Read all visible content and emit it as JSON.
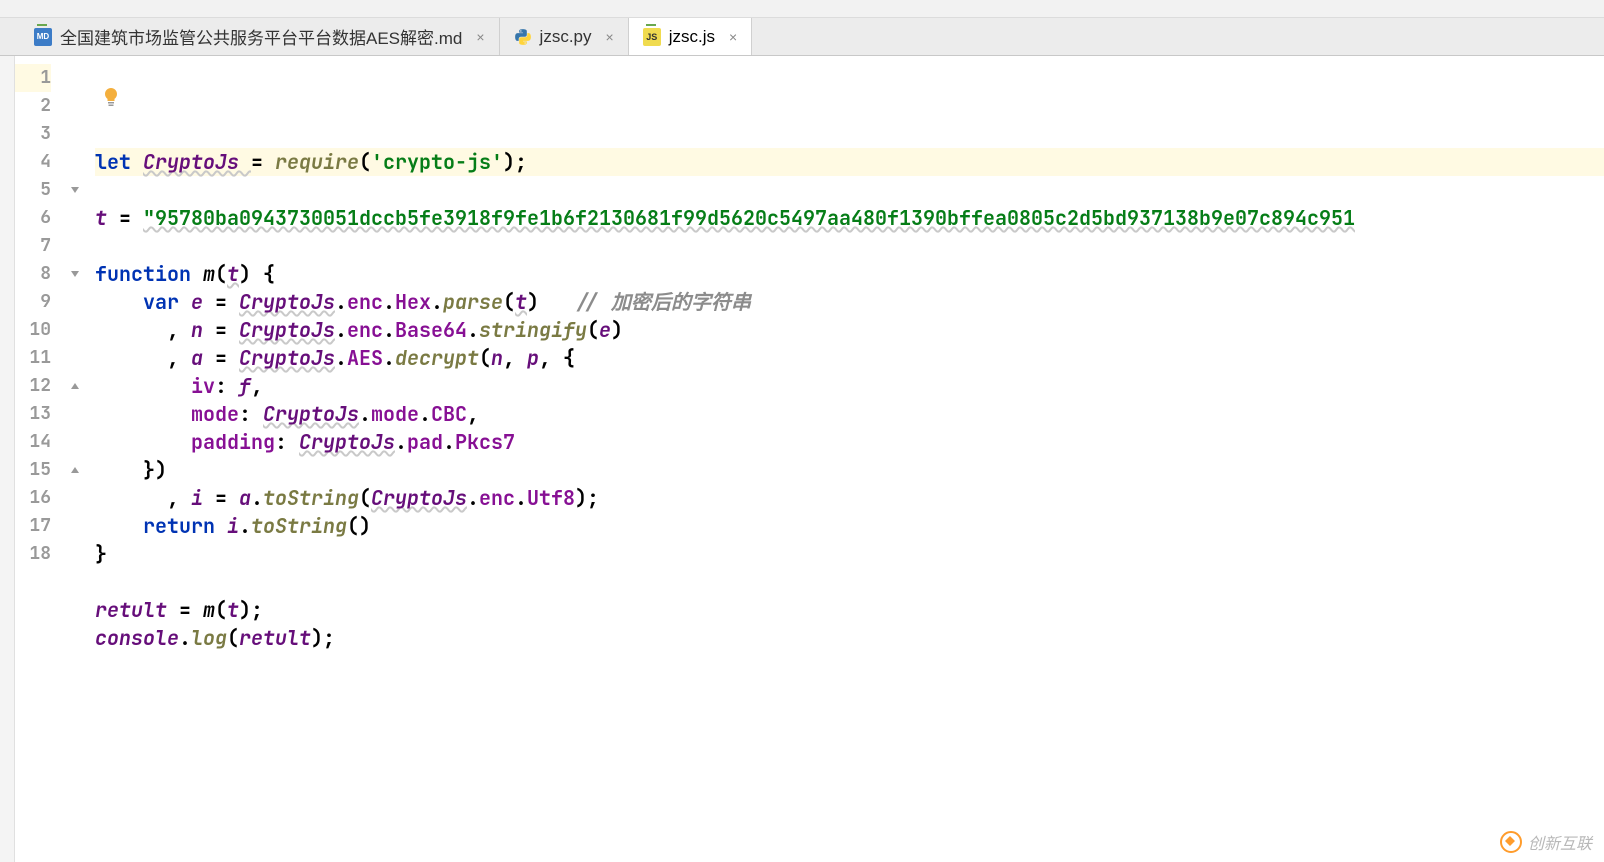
{
  "tabs": [
    {
      "label": "全国建筑市场监管公共服务平台平台数据AES解密.md",
      "icon": "md",
      "active": false
    },
    {
      "label": "jzsc.py",
      "icon": "py",
      "active": false
    },
    {
      "label": "jzsc.js",
      "icon": "js",
      "active": true
    }
  ],
  "gutter": {
    "start": 1,
    "end": 18
  },
  "code": {
    "lines": [
      {
        "n": 1,
        "highlighted": true,
        "fold": "",
        "tokens": [
          {
            "t": "let ",
            "c": "kw"
          },
          {
            "t": "CryptoJs ",
            "c": "id underline"
          },
          {
            "t": "= ",
            "c": "pn"
          },
          {
            "t": "require",
            "c": "method"
          },
          {
            "t": "(",
            "c": "pn"
          },
          {
            "t": "'crypto-js'",
            "c": "str"
          },
          {
            "t": ");",
            "c": "pn"
          }
        ]
      },
      {
        "n": 2,
        "tokens": []
      },
      {
        "n": 3,
        "tokens": [
          {
            "t": "t ",
            "c": "id"
          },
          {
            "t": "= ",
            "c": "pn"
          },
          {
            "t": "\"95780ba0943730051dccb5fe3918f9fe1b6f2130681f99d5620c5497aa480f1390bffea0805c2d5bd937138b9e07c894c951",
            "c": "str underline"
          }
        ]
      },
      {
        "n": 4,
        "tokens": []
      },
      {
        "n": 5,
        "fold": "open",
        "tokens": [
          {
            "t": "function ",
            "c": "kw"
          },
          {
            "t": "m",
            "c": "fn"
          },
          {
            "t": "(",
            "c": "pn"
          },
          {
            "t": "t",
            "c": "id underline"
          },
          {
            "t": ") {",
            "c": "pn"
          }
        ]
      },
      {
        "n": 6,
        "tokens": [
          {
            "t": "    ",
            "c": ""
          },
          {
            "t": "var ",
            "c": "kw"
          },
          {
            "t": "e ",
            "c": "id"
          },
          {
            "t": "= ",
            "c": "pn"
          },
          {
            "t": "CryptoJs",
            "c": "id underline"
          },
          {
            "t": ".",
            "c": "pn"
          },
          {
            "t": "enc",
            "c": "prop"
          },
          {
            "t": ".",
            "c": "pn"
          },
          {
            "t": "Hex",
            "c": "prop"
          },
          {
            "t": ".",
            "c": "pn"
          },
          {
            "t": "parse",
            "c": "method"
          },
          {
            "t": "(",
            "c": "pn"
          },
          {
            "t": "t",
            "c": "id underline"
          },
          {
            "t": ")   ",
            "c": "pn"
          },
          {
            "t": "// 加密后的字符串",
            "c": "cm"
          }
        ]
      },
      {
        "n": 7,
        "tokens": [
          {
            "t": "      , ",
            "c": "pn"
          },
          {
            "t": "n ",
            "c": "id"
          },
          {
            "t": "= ",
            "c": "pn"
          },
          {
            "t": "CryptoJs",
            "c": "id underline"
          },
          {
            "t": ".",
            "c": "pn"
          },
          {
            "t": "enc",
            "c": "prop"
          },
          {
            "t": ".",
            "c": "pn"
          },
          {
            "t": "Base64",
            "c": "prop"
          },
          {
            "t": ".",
            "c": "pn"
          },
          {
            "t": "stringify",
            "c": "method"
          },
          {
            "t": "(",
            "c": "pn"
          },
          {
            "t": "e",
            "c": "id"
          },
          {
            "t": ")",
            "c": "pn"
          }
        ]
      },
      {
        "n": 8,
        "fold": "open",
        "tokens": [
          {
            "t": "      , ",
            "c": "pn"
          },
          {
            "t": "a ",
            "c": "id"
          },
          {
            "t": "= ",
            "c": "pn"
          },
          {
            "t": "CryptoJs",
            "c": "id underline"
          },
          {
            "t": ".",
            "c": "pn"
          },
          {
            "t": "AES",
            "c": "prop"
          },
          {
            "t": ".",
            "c": "pn"
          },
          {
            "t": "decrypt",
            "c": "method"
          },
          {
            "t": "(",
            "c": "pn"
          },
          {
            "t": "n",
            "c": "id"
          },
          {
            "t": ", ",
            "c": "pn"
          },
          {
            "t": "p",
            "c": "id"
          },
          {
            "t": ", {",
            "c": "pn"
          }
        ]
      },
      {
        "n": 9,
        "tokens": [
          {
            "t": "        ",
            "c": ""
          },
          {
            "t": "iv",
            "c": "prop"
          },
          {
            "t": ": ",
            "c": "pn"
          },
          {
            "t": "f",
            "c": "id"
          },
          {
            "t": ",",
            "c": "pn"
          }
        ]
      },
      {
        "n": 10,
        "tokens": [
          {
            "t": "        ",
            "c": ""
          },
          {
            "t": "mode",
            "c": "prop"
          },
          {
            "t": ": ",
            "c": "pn"
          },
          {
            "t": "CryptoJs",
            "c": "id underline"
          },
          {
            "t": ".",
            "c": "pn"
          },
          {
            "t": "mode",
            "c": "prop"
          },
          {
            "t": ".",
            "c": "pn"
          },
          {
            "t": "CBC",
            "c": "prop"
          },
          {
            "t": ",",
            "c": "pn"
          }
        ]
      },
      {
        "n": 11,
        "tokens": [
          {
            "t": "        ",
            "c": ""
          },
          {
            "t": "padding",
            "c": "prop"
          },
          {
            "t": ": ",
            "c": "pn"
          },
          {
            "t": "CryptoJs",
            "c": "id underline"
          },
          {
            "t": ".",
            "c": "pn"
          },
          {
            "t": "pad",
            "c": "prop"
          },
          {
            "t": ".",
            "c": "pn"
          },
          {
            "t": "Pkcs7",
            "c": "prop"
          }
        ]
      },
      {
        "n": 12,
        "fold": "close",
        "tokens": [
          {
            "t": "    })",
            "c": "pn"
          }
        ]
      },
      {
        "n": 13,
        "tokens": [
          {
            "t": "      , ",
            "c": "pn"
          },
          {
            "t": "i ",
            "c": "id"
          },
          {
            "t": "= ",
            "c": "pn"
          },
          {
            "t": "a",
            "c": "id"
          },
          {
            "t": ".",
            "c": "pn"
          },
          {
            "t": "toString",
            "c": "method"
          },
          {
            "t": "(",
            "c": "pn"
          },
          {
            "t": "CryptoJs",
            "c": "id underline"
          },
          {
            "t": ".",
            "c": "pn"
          },
          {
            "t": "enc",
            "c": "prop"
          },
          {
            "t": ".",
            "c": "pn"
          },
          {
            "t": "Utf8",
            "c": "prop"
          },
          {
            "t": ");",
            "c": "pn"
          }
        ]
      },
      {
        "n": 14,
        "tokens": [
          {
            "t": "    ",
            "c": ""
          },
          {
            "t": "return ",
            "c": "kw"
          },
          {
            "t": "i",
            "c": "id"
          },
          {
            "t": ".",
            "c": "pn"
          },
          {
            "t": "toString",
            "c": "method"
          },
          {
            "t": "()",
            "c": "pn"
          }
        ]
      },
      {
        "n": 15,
        "fold": "close",
        "tokens": [
          {
            "t": "}",
            "c": "pn"
          }
        ]
      },
      {
        "n": 16,
        "tokens": []
      },
      {
        "n": 17,
        "tokens": [
          {
            "t": "retult ",
            "c": "id"
          },
          {
            "t": "= ",
            "c": "pn"
          },
          {
            "t": "m",
            "c": "fn"
          },
          {
            "t": "(",
            "c": "pn"
          },
          {
            "t": "t",
            "c": "id"
          },
          {
            "t": ");",
            "c": "pn"
          }
        ]
      },
      {
        "n": 18,
        "tokens": [
          {
            "t": "console",
            "c": "id"
          },
          {
            "t": ".",
            "c": "pn"
          },
          {
            "t": "log",
            "c": "method"
          },
          {
            "t": "(",
            "c": "pn"
          },
          {
            "t": "retult",
            "c": "id"
          },
          {
            "t": ");",
            "c": "pn"
          }
        ]
      }
    ]
  },
  "watermark": "创新互联"
}
